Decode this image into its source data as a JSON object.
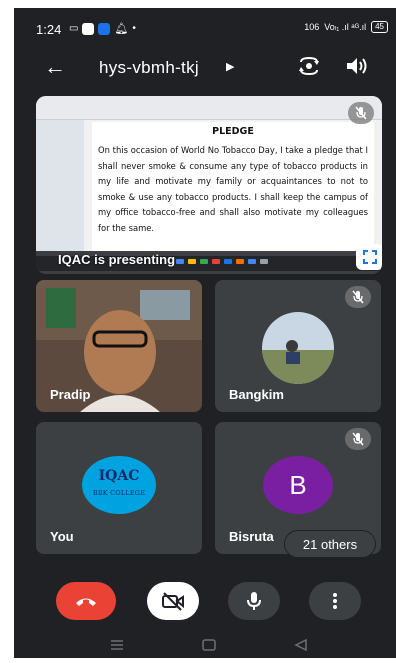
{
  "status_bar": {
    "time": "1:24",
    "net_speed": "106",
    "signal": "Voₗ₁ .ıl ᵃᴳ.ıl",
    "battery": "45"
  },
  "header": {
    "meeting_code": "hys-vbmh-tkj",
    "icons": [
      "back-arrow-icon",
      "caret-right-icon",
      "switch-camera-icon",
      "speaker-icon"
    ]
  },
  "presentation": {
    "presenter_label": "IQAC is presenting",
    "document": {
      "title": "PLEDGE",
      "body": "On this occasion of World No Tobacco Day, I take a pledge that I shall never smoke & consume any type of tobacco products in my life and motivate my family or acquaintances to not to smoke & use any tobacco products. I shall keep the campus of my office tobacco-free and shall also motivate my colleagues for the same."
    }
  },
  "participants": [
    {
      "name": "Pradip",
      "type": "video",
      "muted": false
    },
    {
      "name": "Bangkim",
      "type": "photo",
      "muted": true
    },
    {
      "name": "You",
      "type": "logo",
      "logo_title": "IQAC",
      "logo_subtitle": "BBK COLLEGE",
      "muted": false
    },
    {
      "name": "Bisruta",
      "type": "letter",
      "initial": "B",
      "avatar_color": "#7b1fa2",
      "muted": true
    }
  ],
  "others_label": "21 others",
  "controls": [
    "end-call",
    "camera-off",
    "microphone",
    "more-options"
  ],
  "colors": {
    "background": "#202124",
    "tile": "#3c4043",
    "end_call": "#ea4335",
    "avatar_purple": "#7b1fa2",
    "logo_blue": "#00a3e0"
  }
}
